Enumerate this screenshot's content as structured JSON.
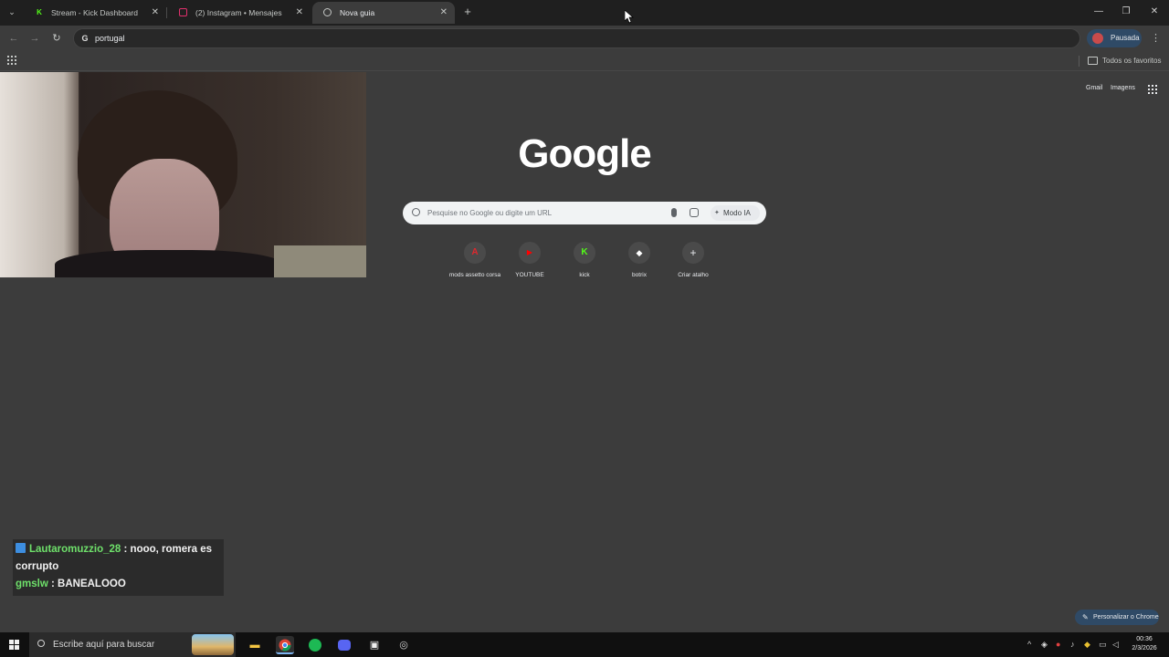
{
  "browser": {
    "tabs": [
      {
        "title": "Stream - Kick Dashboard",
        "favicon": "kick-icon",
        "color": "#53fc18"
      },
      {
        "title": "(2) Instagram • Mensajes",
        "favicon": "instagram-icon",
        "color": "#e1306c"
      },
      {
        "title": "Nova guia",
        "favicon": "chrome-icon",
        "color": "#c4c7c5"
      }
    ],
    "active_tab": 2,
    "new_tab": "+",
    "window_controls": {
      "minimize": "—",
      "restore": "❐",
      "close": "✕"
    },
    "address": "portugal",
    "profile_label": "Pausada",
    "bookmarks_all": "Todos os favoritos"
  },
  "ntp": {
    "top_links": {
      "gmail": "Gmail",
      "images": "Imagens"
    },
    "logo": "Google",
    "search_placeholder": "Pesquise no Google ou digite um URL",
    "mode_label": "Modo IA",
    "shortcuts": [
      {
        "label": "mods assetto corsa",
        "icon": "assetto-icon",
        "glyph": "A",
        "color": "#e0282e"
      },
      {
        "label": "YOUTUBE",
        "icon": "youtube-icon",
        "glyph": "▶",
        "color": "#ff0000"
      },
      {
        "label": "kick",
        "icon": "kick-icon",
        "glyph": "K",
        "color": "#53fc18"
      },
      {
        "label": "botrix",
        "icon": "botrix-icon",
        "glyph": "◆",
        "color": "#ffffff"
      },
      {
        "label": "Criar atalho",
        "icon": "add-shortcut-icon",
        "glyph": "+",
        "color": "#e8eaed"
      }
    ],
    "customize_label": "Personalizar o Chrome"
  },
  "chat": {
    "messages": [
      {
        "user": "Lautaromuzzio_28",
        "text": ": nooo, romera es corrupto"
      },
      {
        "user": "gmslw",
        "text": ": BANEALOOO"
      }
    ]
  },
  "taskbar": {
    "search_placeholder": "Escribe aquí para buscar",
    "time": "00:36",
    "date": "2/3/2026"
  }
}
